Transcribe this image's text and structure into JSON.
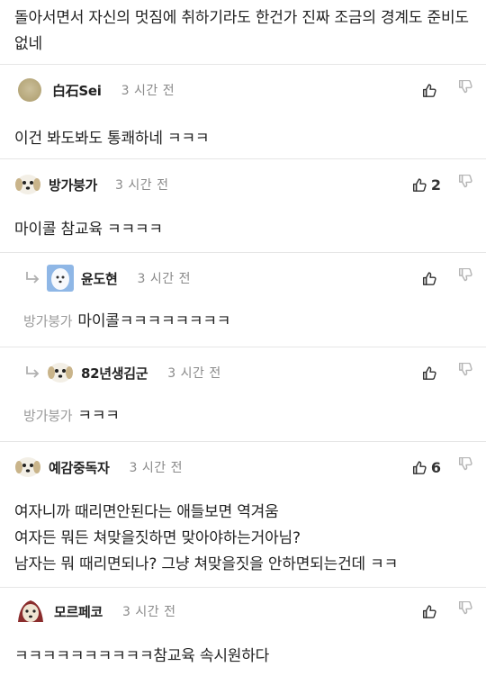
{
  "article_tail": "돌아서면서 자신의 멋짐에 취하기라도 한건가 진짜 조금의 경계도 준비도 없네",
  "colors": {
    "text": "#222222",
    "muted": "#8a8a8a",
    "divider": "#e6e6e6",
    "icon": "#333333",
    "icon_muted": "#b5b5b5"
  },
  "comments": [
    {
      "nick": "白石Sei",
      "time": "3 시간 전",
      "up_count": "",
      "lines": [
        "이건 봐도봐도 통쾌하네 ㅋㅋㅋ"
      ]
    },
    {
      "nick": "방가붕가",
      "time": "3 시간 전",
      "up_count": "2",
      "lines": [
        "마이콜 참교육 ㅋㅋㅋㅋ"
      ]
    },
    {
      "nick": "윤도현",
      "time": "3 시간 전",
      "up_count": "",
      "mention": "방가붕가",
      "lines": [
        "마이콜ㅋㅋㅋㅋㅋㅋㅋㅋ"
      ]
    },
    {
      "nick": "82년생김군",
      "time": "3 시간 전",
      "up_count": "",
      "mention": "방가붕가",
      "lines": [
        "ㅋㅋㅋ"
      ]
    },
    {
      "nick": "예감중독자",
      "time": "3 시간 전",
      "up_count": "6",
      "lines": [
        "여자니까 때리면안된다는 애들보면 역겨움",
        "여자든 뭐든 쳐맞을짓하면 맞아야하는거아님?",
        "남자는 뭐 때리면되나? 그냥 쳐맞을짓을 안하면되는건데 ㅋㅋ"
      ]
    },
    {
      "nick": "모르페코",
      "time": "3 시간 전",
      "up_count": "",
      "lines": [
        "ㅋㅋㅋㅋㅋㅋㅋㅋㅋㅋ참교육 속시원하다"
      ]
    }
  ],
  "icons": {
    "like": "thumbs-up-icon",
    "dislike": "thumbs-down-icon",
    "reply": "reply-arrow-icon"
  }
}
